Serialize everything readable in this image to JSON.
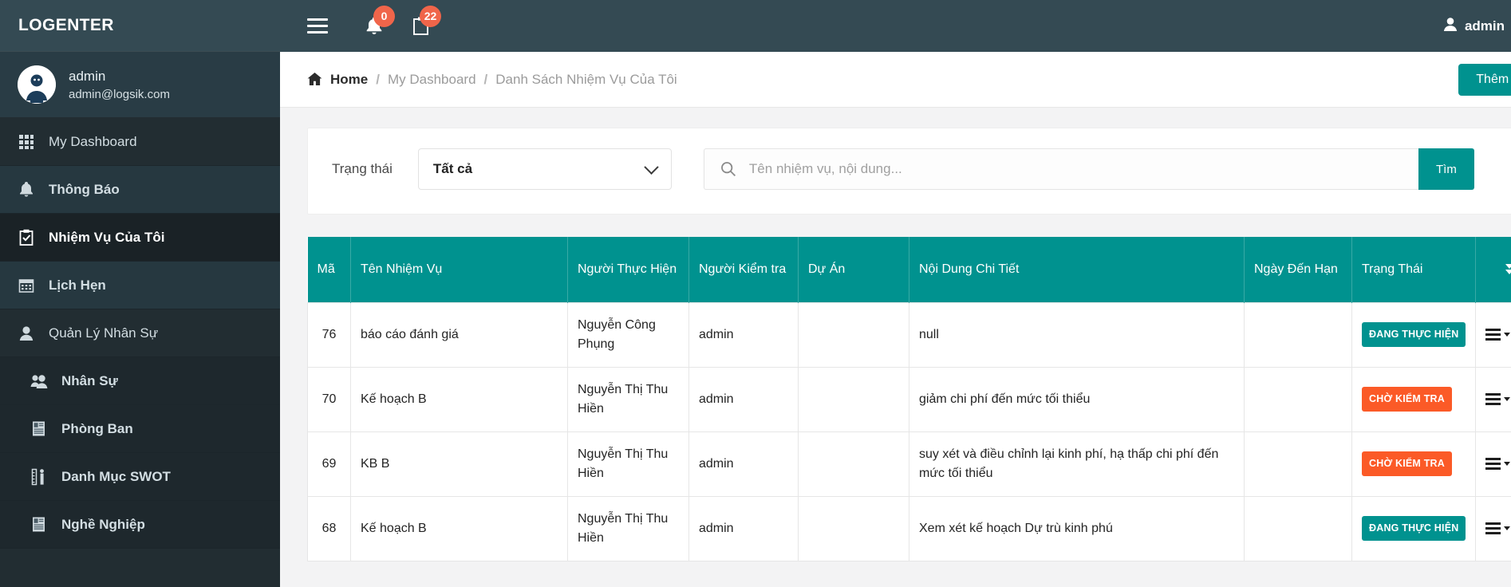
{
  "brand": {
    "title": "LOGENTER"
  },
  "sidebar": {
    "user": {
      "name": "admin",
      "email": "admin@logsik.com",
      "avatar_label": "ADMIN"
    },
    "items": [
      {
        "label": "My Dashboard",
        "icon": "grid-icon",
        "style": "plain"
      },
      {
        "label": "Thông Báo",
        "icon": "bell-icon",
        "style": "bold"
      },
      {
        "label": "Nhiệm Vụ Của Tôi",
        "icon": "clipboard-check-icon",
        "style": "active"
      },
      {
        "label": "Lịch Hẹn",
        "icon": "calendar-icon",
        "style": "bold"
      },
      {
        "label": "Quản Lý Nhân Sự",
        "icon": "user-icon",
        "style": "plain"
      },
      {
        "label": "Nhân Sự",
        "icon": "users-icon",
        "style": "sub"
      },
      {
        "label": "Phòng Ban",
        "icon": "id-card-icon",
        "style": "sub"
      },
      {
        "label": "Danh Mục SWOT",
        "icon": "ruler-person-icon",
        "style": "sub"
      },
      {
        "label": "Nghề Nghiệp",
        "icon": "id-card-icon",
        "style": "sub"
      }
    ]
  },
  "topbar": {
    "menu_icon": "hamburger-icon",
    "notifications": {
      "icon": "bell-icon",
      "count": "0"
    },
    "tasks": {
      "icon": "clipboard-icon",
      "count": "22"
    },
    "user_label": "admin"
  },
  "breadcrumb": {
    "home": "Home",
    "separator": "/",
    "middle": "My Dashboard",
    "current": "Danh Sách Nhiệm Vụ Của Tôi"
  },
  "actions": {
    "add_new": "Thêm Mới"
  },
  "filters": {
    "status_label": "Trạng thái",
    "status_value": "Tất cả",
    "status_options": [
      "Tất cả"
    ],
    "search_placeholder": "Tên nhiệm vụ, nội dung...",
    "search_value": "",
    "search_button": "Tìm"
  },
  "table": {
    "columns": [
      "Mã",
      "Tên Nhiệm Vụ",
      "Người Thực Hiện",
      "Người Kiểm tra",
      "Dự Án",
      "Nội Dung Chi Tiết",
      "Ngày Đến Hạn",
      "Trạng Thái",
      ""
    ],
    "rows": [
      {
        "id": "76",
        "name": "báo cáo đánh giá",
        "doer": "Nguyễn Công Phụng",
        "checker": "admin",
        "project": "",
        "detail": "null",
        "due": "",
        "status": "ĐANG THỰC HIỆN",
        "status_color": "teal"
      },
      {
        "id": "70",
        "name": "Kế hoạch B",
        "doer": "Nguyễn Thị Thu Hiền",
        "checker": "admin",
        "project": "",
        "detail": "giảm chi phí đến mức tối thiểu",
        "due": "",
        "status": "CHỜ KIỂM TRA",
        "status_color": "orange"
      },
      {
        "id": "69",
        "name": "KB B",
        "doer": "Nguyễn Thị Thu Hiền",
        "checker": "admin",
        "project": "",
        "detail": "suy xét và điều chỉnh lại kinh phí, hạ thấp chi phí đến mức tối thiểu",
        "due": "",
        "status": "CHỜ KIỂM TRA",
        "status_color": "orange"
      },
      {
        "id": "68",
        "name": "Kế hoạch B",
        "doer": "Nguyễn Thị Thu Hiền",
        "checker": "admin",
        "project": "",
        "detail": "Xem xét kế hoạch Dự trù kinh phú",
        "due": "",
        "status": "ĐANG THỰC HIỆN",
        "status_color": "teal"
      }
    ]
  },
  "colors": {
    "sidebar_bg": "#222d32",
    "topbar_bg": "#344a53",
    "accent_teal": "#00928f",
    "accent_orange": "#fb5a27",
    "badge_orange": "#f0654a",
    "link_blue": "#2d7ad4"
  }
}
